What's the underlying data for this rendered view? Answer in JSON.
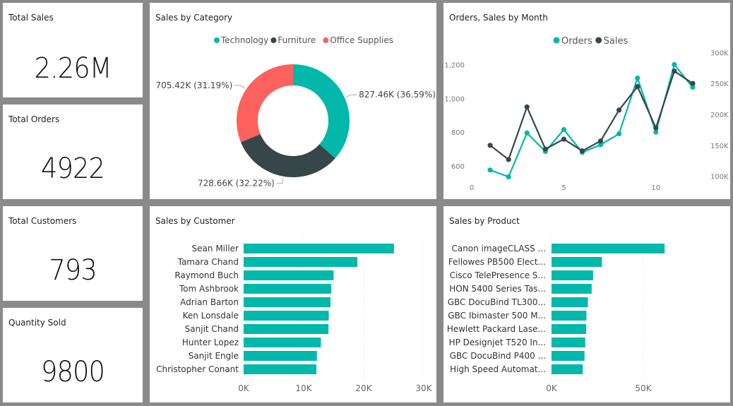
{
  "colors": {
    "teal": "#01b8aa",
    "dark": "#374649",
    "red": "#fd625e",
    "grid": "#d0d0d0",
    "axis_text": "#777777"
  },
  "kpis": [
    {
      "title": "Total Sales",
      "value": "2.26M"
    },
    {
      "title": "Total Orders",
      "value": "4922"
    },
    {
      "title": "Total Customers",
      "value": "793"
    },
    {
      "title": "Quantity Sold",
      "value": "9800"
    }
  ],
  "category_panel": {
    "title": "Sales by Category",
    "chart_data": {
      "type": "pie",
      "title": "Sales by Category",
      "legend_position": "top-center",
      "slices": [
        {
          "name": "Technology",
          "value": 827.46,
          "label": "827.46K (36.59%)",
          "color": "#01b8aa"
        },
        {
          "name": "Furniture",
          "value": 728.66,
          "label": "728.66K (32.22%)",
          "color": "#374649"
        },
        {
          "name": "Office Supplies",
          "value": 705.42,
          "label": "705.42K (31.19%)",
          "color": "#fd625e"
        }
      ]
    }
  },
  "monthly_panel": {
    "title": "Orders, Sales by Month",
    "chart_data": {
      "type": "line",
      "title": "Orders, Sales by Month",
      "legend_position": "top-center",
      "grid": false,
      "x": [
        1,
        2,
        3,
        4,
        5,
        6,
        7,
        8,
        9,
        10,
        11,
        12
      ],
      "x_ticks": [
        "0",
        "5",
        "10"
      ],
      "xlim": [
        0,
        12.5
      ],
      "y_left_ticks": [
        "600",
        "800",
        "1,000",
        "1,200"
      ],
      "y_left_lim": [
        520,
        1290
      ],
      "y_right_ticks": [
        "100K",
        "150K",
        "200K",
        "250K",
        "300K"
      ],
      "y_right_lim": [
        95000,
        305000
      ],
      "series": [
        {
          "name": "Orders",
          "axis": "left",
          "color": "#01b8aa",
          "values": [
            575,
            535,
            795,
            685,
            815,
            680,
            725,
            790,
            1120,
            800,
            1200,
            1065
          ]
        },
        {
          "name": "Sales",
          "axis": "right",
          "color": "#374649",
          "values": [
            150000,
            127000,
            212000,
            144000,
            160000,
            141000,
            157000,
            207000,
            245000,
            178000,
            270000,
            250000
          ]
        }
      ]
    }
  },
  "customer_panel": {
    "title": "Sales by Customer",
    "chart_data": {
      "type": "bar",
      "orientation": "horizontal",
      "title": "Sales by Customer",
      "categories": [
        "Sean Miller",
        "Tamara Chand",
        "Raymond Buch",
        "Tom Ashbrook",
        "Adrian Barton",
        "Ken Lonsdale",
        "Sanjit Chand",
        "Hunter Lopez",
        "Sanjit Engle",
        "Christopher Conant"
      ],
      "values": [
        25040,
        18950,
        14990,
        14600,
        14470,
        14180,
        14140,
        12870,
        12210,
        12130
      ],
      "x_ticks": [
        "0K",
        "10K",
        "20K",
        "30K"
      ],
      "xlim": [
        0,
        30000
      ],
      "color": "#01b8aa"
    }
  },
  "product_panel": {
    "title": "Sales by Product",
    "chart_data": {
      "type": "bar",
      "orientation": "horizontal",
      "title": "Sales by Product",
      "categories": [
        "Canon imageCLASS ...",
        "Fellowes PB500 Elect...",
        "Cisco TelePresence S...",
        "HON 5400 Series Tas...",
        "GBC DocuBind TL300...",
        "GBC Ibimaster 500 M...",
        "Hewlett Packard Lase...",
        "HP Designjet T520 In...",
        "GBC DocuBind P400 ...",
        "High Speed Automat..."
      ],
      "values": [
        61600,
        27450,
        22640,
        21870,
        19820,
        19020,
        18840,
        18370,
        17970,
        17030
      ],
      "x_ticks": [
        "0K",
        "50K"
      ],
      "x_tick_values": [
        0,
        50000
      ],
      "xlim": [
        0,
        85000
      ],
      "color": "#01b8aa"
    }
  }
}
